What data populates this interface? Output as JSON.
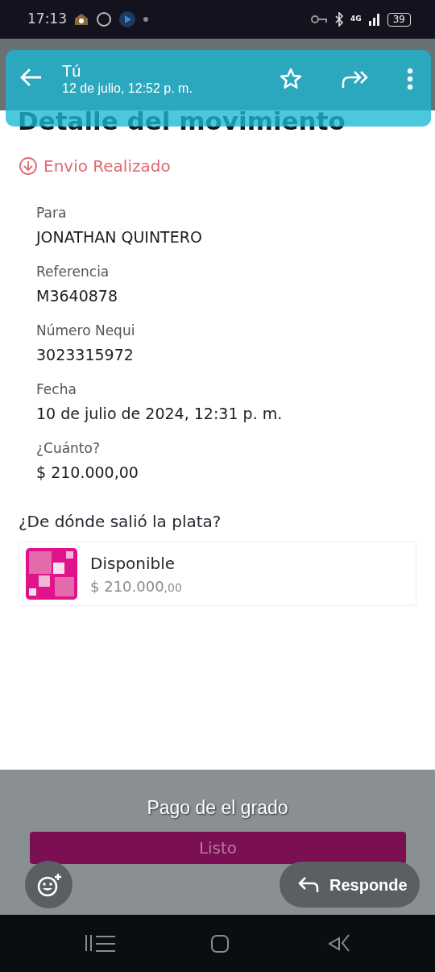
{
  "status_bar": {
    "time": "17:13",
    "network": "4G",
    "battery": "39"
  },
  "viewer_header": {
    "title": "Tú",
    "subtitle": "12 de julio, 12:52 p. m."
  },
  "app": {
    "title": "Detalle del movimiento",
    "status": "Envio Realizado",
    "fields": [
      {
        "label": "Para",
        "value": "JONATHAN QUINTERO"
      },
      {
        "label": "Referencia",
        "value": "M3640878"
      },
      {
        "label": "Número Nequi",
        "value": "3023315972"
      },
      {
        "label": "Fecha",
        "value": "10 de julio de 2024, 12:31 p. m."
      },
      {
        "label": "¿Cuánto?",
        "value": "$ 210.000,00"
      }
    ],
    "source_heading": "¿De dónde salió la plata?",
    "source": {
      "name": "Disponible",
      "amount": "$ 210.000",
      "cents": ",00"
    },
    "done_button": "Listo"
  },
  "caption": "Pago de el grado",
  "reply_button": "Responde"
}
